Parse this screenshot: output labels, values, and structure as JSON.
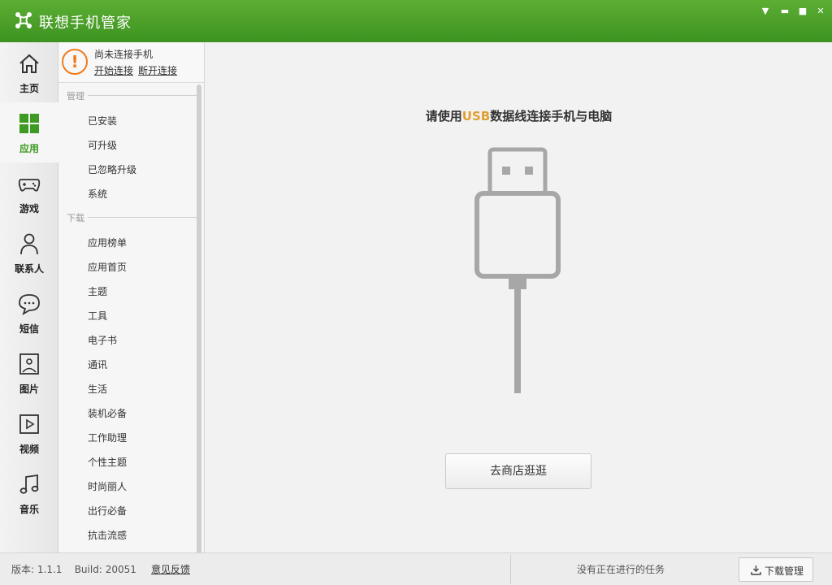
{
  "window": {
    "title": "联想手机管家",
    "controls": [
      "menu-dropdown-icon",
      "minimize-icon",
      "maximize-icon",
      "close-icon"
    ]
  },
  "colors": {
    "titlebar": "#4aa22a",
    "accent_green": "#3d9a22",
    "warning_orange": "#f07a1c",
    "usb_highlight": "#e0a030"
  },
  "nav": [
    {
      "label": "主页",
      "icon": "home-icon",
      "active": false
    },
    {
      "label": "应用",
      "icon": "apps-grid-icon",
      "active": true
    },
    {
      "label": "游戏",
      "icon": "gamepad-icon",
      "active": false
    },
    {
      "label": "联系人",
      "icon": "contact-person-icon",
      "active": false
    },
    {
      "label": "短信",
      "icon": "message-bubble-icon",
      "active": false
    },
    {
      "label": "图片",
      "icon": "picture-icon",
      "active": false
    },
    {
      "label": "视频",
      "icon": "video-play-icon",
      "active": false
    },
    {
      "label": "音乐",
      "icon": "music-note-icon",
      "active": false
    }
  ],
  "connection": {
    "status": "尚未连接手机",
    "connect_link": "开始连接",
    "disconnect_link": "断开连接"
  },
  "categories": {
    "manage": {
      "header": "管理",
      "items": [
        "已安装",
        "可升级",
        "已忽略升级",
        "系统"
      ]
    },
    "download": {
      "header": "下载",
      "items": [
        "应用榜单",
        "应用首页",
        "主题",
        "工具",
        "电子书",
        "通讯",
        "生活",
        "装机必备",
        "工作助理",
        "个性主题",
        "时尚丽人",
        "出行必备",
        "抗击流感"
      ]
    }
  },
  "main": {
    "title_prefix": "请使用",
    "title_highlight": "USB",
    "title_suffix": "数据线连接手机与电脑",
    "store_button": "去商店逛逛"
  },
  "footer": {
    "version_label": "版本:",
    "version": "1.1.1",
    "build_label": "Build:",
    "build": "20051",
    "feedback": "意见反馈",
    "task_status": "没有正在进行的任务",
    "download_manager": "下载管理"
  }
}
